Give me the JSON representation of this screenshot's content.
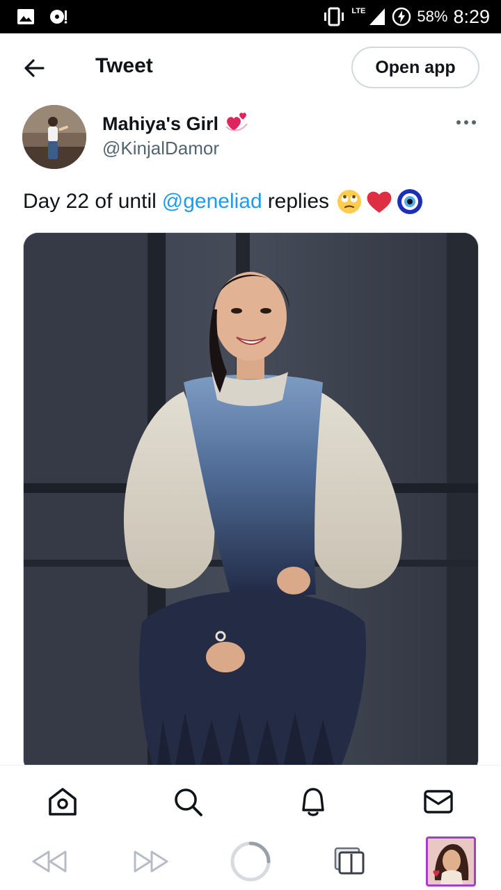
{
  "status_bar": {
    "network_type": "LTE",
    "battery_percent": "58%",
    "time": "8:29",
    "icons": [
      "image-icon",
      "media-icon",
      "vibrate-icon",
      "signal-icon",
      "battery-icon"
    ]
  },
  "header": {
    "title": "Tweet",
    "open_app_label": "Open app"
  },
  "tweet": {
    "author": {
      "display_name": "Mahiya's Girl",
      "username": "@KinjalDamor",
      "name_emoji": "revolving-hearts-icon"
    },
    "text_before": "Day 22 of until",
    "mention": "@geneliad",
    "text_after": "replies",
    "emojis": [
      "face-with-rolling-eyes-icon",
      "red-heart-icon",
      "nazar-amulet-icon"
    ]
  },
  "bottom_nav": {
    "items": [
      "home-icon",
      "search-icon",
      "notifications-icon",
      "messages-icon"
    ]
  },
  "browser_bar": {
    "items": [
      "back-icon",
      "forward-icon",
      "loading-icon",
      "tabs-icon"
    ]
  },
  "colors": {
    "link": "#1d9bf0",
    "secondary_text": "#536471",
    "border": "#cfd9de",
    "primary_text": "#0f1419"
  }
}
